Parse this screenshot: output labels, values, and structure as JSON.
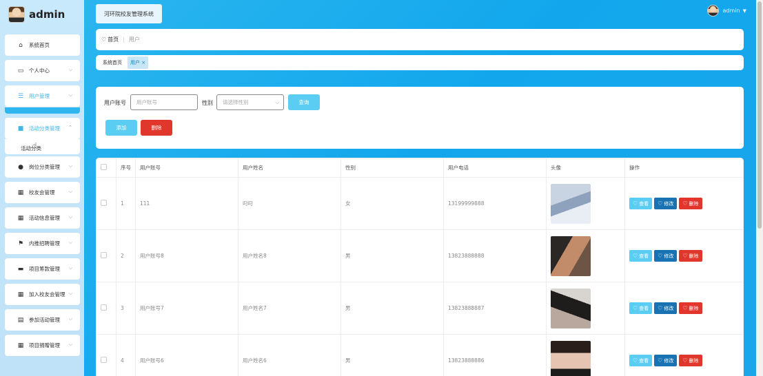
{
  "brand": {
    "name": "admin"
  },
  "sidebar": {
    "items": [
      {
        "label": "系统首页",
        "icon": "home-icon",
        "glyph": "⌂"
      },
      {
        "label": "个人中心",
        "icon": "calendar-icon",
        "glyph": "▭"
      },
      {
        "label": "用户管理",
        "icon": "sliders-icon",
        "glyph": "☰"
      },
      {
        "label": "活动分类管理",
        "icon": "document-icon",
        "glyph": "■"
      },
      {
        "label": "岗位分类管理",
        "icon": "pin-icon",
        "glyph": "●"
      },
      {
        "label": "校友会管理",
        "icon": "grid-icon",
        "glyph": "▦"
      },
      {
        "label": "活动信息管理",
        "icon": "grid-icon",
        "glyph": "▦"
      },
      {
        "label": "内推招聘管理",
        "icon": "flag-icon",
        "glyph": "⚑"
      },
      {
        "label": "项目筹款管理",
        "icon": "briefcase-icon",
        "glyph": "▬"
      },
      {
        "label": "加入校友会管理",
        "icon": "grid-icon",
        "glyph": "▦"
      },
      {
        "label": "参加活动管理",
        "icon": "clipboard-icon",
        "glyph": "▤"
      },
      {
        "label": "项目捐赠管理",
        "icon": "grid-icon",
        "glyph": "▦"
      }
    ],
    "submenu_label": "活动分类"
  },
  "header": {
    "system_title": "河环院校友管理系统",
    "user_name": "admin"
  },
  "breadcrumb": {
    "home": "首页",
    "current": "用户"
  },
  "tags": {
    "home": "系统首页",
    "active": "用户",
    "close": "×"
  },
  "search": {
    "account_label": "用户账号",
    "account_placeholder": "用户账号",
    "gender_label": "性别",
    "gender_placeholder": "请选择性别",
    "query_button": "查询",
    "add_button": "添加",
    "delete_button": "删除"
  },
  "table": {
    "headers": [
      "序号",
      "用户账号",
      "用户姓名",
      "性别",
      "用户电话",
      "头像",
      "操作"
    ],
    "rows": [
      {
        "index": "1",
        "account": "111",
        "name": "叼叼",
        "gender": "女",
        "phone": "13199999888"
      },
      {
        "index": "2",
        "account": "用户账号8",
        "name": "用户姓名8",
        "gender": "男",
        "phone": "13823888888"
      },
      {
        "index": "3",
        "account": "用户账号7",
        "name": "用户姓名7",
        "gender": "男",
        "phone": "13823888887"
      },
      {
        "index": "4",
        "account": "用户账号6",
        "name": "用户姓名6",
        "gender": "男",
        "phone": "13823888886"
      }
    ],
    "actions": {
      "view": "查看",
      "edit": "修改",
      "delete": "删除"
    }
  },
  "colors": {
    "accent": "#2fb6ef",
    "primary_button": "#5bcdf3",
    "danger": "#e0362b",
    "edit": "#1973b3"
  }
}
